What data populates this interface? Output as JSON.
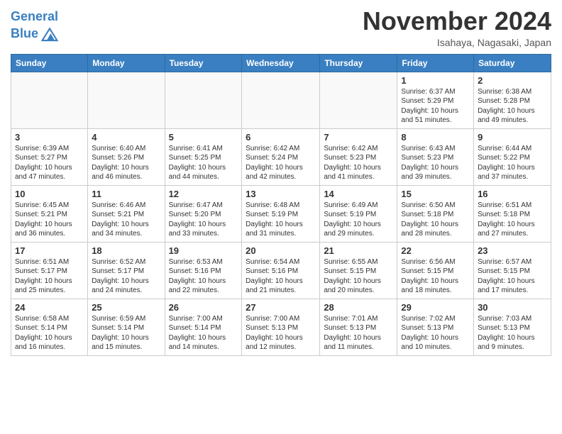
{
  "header": {
    "logo_line1": "General",
    "logo_line2": "Blue",
    "month": "November 2024",
    "location": "Isahaya, Nagasaki, Japan"
  },
  "weekdays": [
    "Sunday",
    "Monday",
    "Tuesday",
    "Wednesday",
    "Thursday",
    "Friday",
    "Saturday"
  ],
  "weeks": [
    [
      {
        "day": "",
        "empty": true
      },
      {
        "day": "",
        "empty": true
      },
      {
        "day": "",
        "empty": true
      },
      {
        "day": "",
        "empty": true
      },
      {
        "day": "",
        "empty": true
      },
      {
        "day": "1",
        "sunrise": "6:37 AM",
        "sunset": "5:29 PM",
        "daylight": "10 hours and 51 minutes."
      },
      {
        "day": "2",
        "sunrise": "6:38 AM",
        "sunset": "5:28 PM",
        "daylight": "10 hours and 49 minutes."
      }
    ],
    [
      {
        "day": "3",
        "sunrise": "6:39 AM",
        "sunset": "5:27 PM",
        "daylight": "10 hours and 47 minutes."
      },
      {
        "day": "4",
        "sunrise": "6:40 AM",
        "sunset": "5:26 PM",
        "daylight": "10 hours and 46 minutes."
      },
      {
        "day": "5",
        "sunrise": "6:41 AM",
        "sunset": "5:25 PM",
        "daylight": "10 hours and 44 minutes."
      },
      {
        "day": "6",
        "sunrise": "6:42 AM",
        "sunset": "5:24 PM",
        "daylight": "10 hours and 42 minutes."
      },
      {
        "day": "7",
        "sunrise": "6:42 AM",
        "sunset": "5:23 PM",
        "daylight": "10 hours and 41 minutes."
      },
      {
        "day": "8",
        "sunrise": "6:43 AM",
        "sunset": "5:23 PM",
        "daylight": "10 hours and 39 minutes."
      },
      {
        "day": "9",
        "sunrise": "6:44 AM",
        "sunset": "5:22 PM",
        "daylight": "10 hours and 37 minutes."
      }
    ],
    [
      {
        "day": "10",
        "sunrise": "6:45 AM",
        "sunset": "5:21 PM",
        "daylight": "10 hours and 36 minutes."
      },
      {
        "day": "11",
        "sunrise": "6:46 AM",
        "sunset": "5:21 PM",
        "daylight": "10 hours and 34 minutes."
      },
      {
        "day": "12",
        "sunrise": "6:47 AM",
        "sunset": "5:20 PM",
        "daylight": "10 hours and 33 minutes."
      },
      {
        "day": "13",
        "sunrise": "6:48 AM",
        "sunset": "5:19 PM",
        "daylight": "10 hours and 31 minutes."
      },
      {
        "day": "14",
        "sunrise": "6:49 AM",
        "sunset": "5:19 PM",
        "daylight": "10 hours and 29 minutes."
      },
      {
        "day": "15",
        "sunrise": "6:50 AM",
        "sunset": "5:18 PM",
        "daylight": "10 hours and 28 minutes."
      },
      {
        "day": "16",
        "sunrise": "6:51 AM",
        "sunset": "5:18 PM",
        "daylight": "10 hours and 27 minutes."
      }
    ],
    [
      {
        "day": "17",
        "sunrise": "6:51 AM",
        "sunset": "5:17 PM",
        "daylight": "10 hours and 25 minutes."
      },
      {
        "day": "18",
        "sunrise": "6:52 AM",
        "sunset": "5:17 PM",
        "daylight": "10 hours and 24 minutes."
      },
      {
        "day": "19",
        "sunrise": "6:53 AM",
        "sunset": "5:16 PM",
        "daylight": "10 hours and 22 minutes."
      },
      {
        "day": "20",
        "sunrise": "6:54 AM",
        "sunset": "5:16 PM",
        "daylight": "10 hours and 21 minutes."
      },
      {
        "day": "21",
        "sunrise": "6:55 AM",
        "sunset": "5:15 PM",
        "daylight": "10 hours and 20 minutes."
      },
      {
        "day": "22",
        "sunrise": "6:56 AM",
        "sunset": "5:15 PM",
        "daylight": "10 hours and 18 minutes."
      },
      {
        "day": "23",
        "sunrise": "6:57 AM",
        "sunset": "5:15 PM",
        "daylight": "10 hours and 17 minutes."
      }
    ],
    [
      {
        "day": "24",
        "sunrise": "6:58 AM",
        "sunset": "5:14 PM",
        "daylight": "10 hours and 16 minutes."
      },
      {
        "day": "25",
        "sunrise": "6:59 AM",
        "sunset": "5:14 PM",
        "daylight": "10 hours and 15 minutes."
      },
      {
        "day": "26",
        "sunrise": "7:00 AM",
        "sunset": "5:14 PM",
        "daylight": "10 hours and 14 minutes."
      },
      {
        "day": "27",
        "sunrise": "7:00 AM",
        "sunset": "5:13 PM",
        "daylight": "10 hours and 12 minutes."
      },
      {
        "day": "28",
        "sunrise": "7:01 AM",
        "sunset": "5:13 PM",
        "daylight": "10 hours and 11 minutes."
      },
      {
        "day": "29",
        "sunrise": "7:02 AM",
        "sunset": "5:13 PM",
        "daylight": "10 hours and 10 minutes."
      },
      {
        "day": "30",
        "sunrise": "7:03 AM",
        "sunset": "5:13 PM",
        "daylight": "10 hours and 9 minutes."
      }
    ]
  ],
  "labels": {
    "sunrise": "Sunrise:",
    "sunset": "Sunset:",
    "daylight": "Daylight:"
  }
}
